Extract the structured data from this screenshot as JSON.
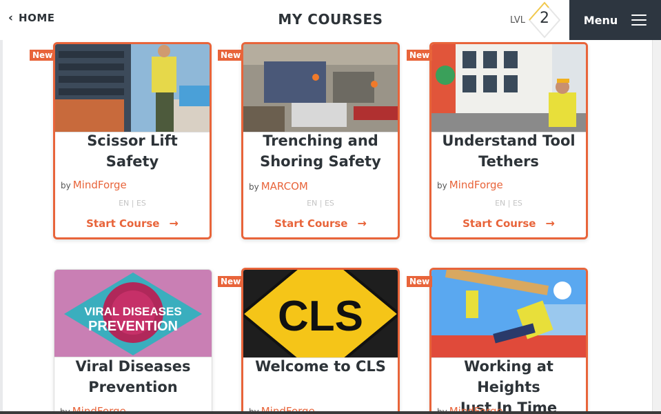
{
  "header": {
    "home_label": "HOME",
    "title": "MY COURSES",
    "level_label": "LVL",
    "level_value": "2",
    "menu_label": "Menu"
  },
  "colors": {
    "accent": "#e8643a",
    "menu_bg": "#2d3640",
    "text": "#2d3338"
  },
  "courses": [
    {
      "title_lines": [
        "Scissor Lift Safety"
      ],
      "badge": "New",
      "by": "by",
      "org": "MindForge",
      "langs": "EN | ES",
      "action": "Start Course"
    },
    {
      "title_lines": [
        "Trenching and",
        "Shoring Safety"
      ],
      "badge": "New",
      "by": "by",
      "org": "MARCOM",
      "langs": "EN | ES",
      "action": "Start Course"
    },
    {
      "title_lines": [
        "Understand Tool",
        "Tethers"
      ],
      "badge": "New",
      "by": "by",
      "org": "MindForge",
      "langs": "EN | ES",
      "action": "Start Course"
    },
    {
      "title_lines": [
        "Viral Diseases",
        "Prevention"
      ],
      "thumb_text": [
        "VIRAL DISEASES",
        "PREVENTION"
      ],
      "by": "by",
      "org": "MindForge"
    },
    {
      "title_lines": [
        "Welcome to CLS"
      ],
      "badge": "New",
      "thumb_text": [
        "CLS"
      ],
      "by": "by",
      "org": "MindForge"
    },
    {
      "title_lines": [
        "Working at Heights",
        "Just In Time"
      ],
      "badge": "New",
      "by": "by",
      "org": "MindForge"
    }
  ]
}
